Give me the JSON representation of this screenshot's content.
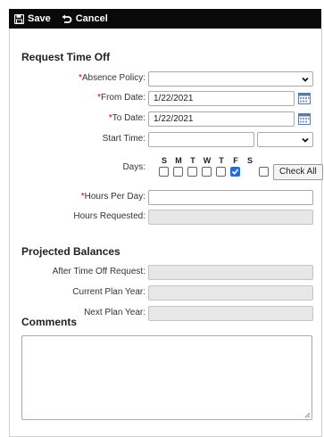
{
  "toolbar": {
    "save_label": "Save",
    "cancel_label": "Cancel"
  },
  "request": {
    "title": "Request Time Off",
    "absence_policy": {
      "label": "Absence Policy:",
      "value": ""
    },
    "from_date": {
      "label": "From Date:",
      "value": "1/22/2021"
    },
    "to_date": {
      "label": "To Date:",
      "value": "1/22/2021"
    },
    "start_time": {
      "label": "Start Time:",
      "value": ""
    },
    "days": {
      "label": "Days:",
      "letters": [
        "S",
        "M",
        "T",
        "W",
        "T",
        "F",
        "S"
      ],
      "checked": [
        false,
        false,
        false,
        false,
        false,
        true,
        false
      ],
      "check_all_label": "Check All"
    },
    "hours_per_day": {
      "label": "Hours Per Day:",
      "value": ""
    },
    "hours_requested": {
      "label": "Hours Requested:",
      "value": ""
    },
    "required_mark": "*"
  },
  "balances": {
    "title": "Projected Balances",
    "after": {
      "label": "After Time Off Request:",
      "value": ""
    },
    "current": {
      "label": "Current Plan Year:",
      "value": ""
    },
    "next": {
      "label": "Next Plan Year:",
      "value": ""
    }
  },
  "comments": {
    "title": "Comments",
    "value": ""
  },
  "colors": {
    "toolbar_bg": "#0a0a0a",
    "checkbox_checked": "#1f6fd6",
    "required": "#cc0000"
  },
  "icons": {
    "save": "floppy-disk-icon",
    "cancel": "undo-arrow-icon",
    "calendar": "calendar-icon",
    "dropdown": "chevron-down-icon"
  }
}
